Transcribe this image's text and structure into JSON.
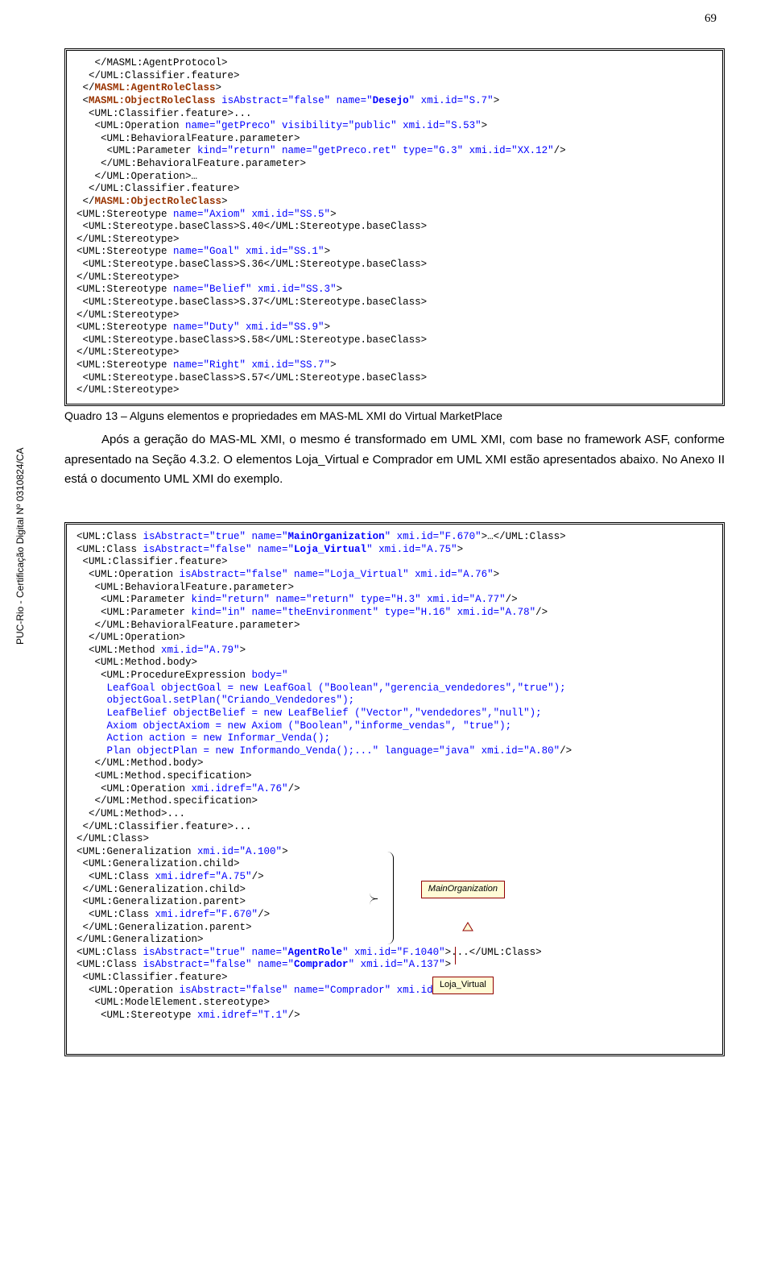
{
  "page_number": "69",
  "vertical_note": "PUC-Rio - Certificação Digital Nº 0310824/CA",
  "code_box_1_html": "   &lt;/MASML:AgentProtocol&gt;\n  &lt;/UML:Classifier.feature&gt;\n &lt;/<span class='brown bold'>MASML:AgentRoleClass</span>&gt;\n &lt;<span class='brown bold'>MASML:ObjectRoleClass</span> <span class='blue'>isAbstract=\"false\"</span> <span class='blue'>name=\"</span><span class='blue bold'>Desejo</span><span class='blue'>\"</span> <span class='blue'>xmi.id=\"S.7\"</span>&gt;\n  &lt;UML:Classifier.feature&gt;...\n   &lt;UML:Operation <span class='blue'>name=\"getPreco\" visibility=\"public\" xmi.id=\"S.53\"</span>&gt;\n    &lt;UML:BehavioralFeature.parameter&gt;\n     &lt;UML:Parameter <span class='blue'>kind=\"return\" name=\"getPreco.ret\" type=\"G.3\" xmi.id=\"XX.12\"</span>/&gt;\n    &lt;/UML:BehavioralFeature.parameter&gt;\n   &lt;/UML:Operation&gt;…\n  &lt;/UML:Classifier.feature&gt;\n &lt;/<span class='brown bold'>MASML:ObjectRoleClass</span>&gt;\n&lt;UML:Stereotype <span class='blue'>name=\"Axiom\" xmi.id=\"SS.5\"</span>&gt;\n &lt;UML:Stereotype.baseClass&gt;S.40&lt;/UML:Stereotype.baseClass&gt;\n&lt;/UML:Stereotype&gt;\n&lt;UML:Stereotype <span class='blue'>name=\"Goal\" xmi.id=\"SS.1\"</span>&gt;\n &lt;UML:Stereotype.baseClass&gt;S.36&lt;/UML:Stereotype.baseClass&gt;\n&lt;/UML:Stereotype&gt;\n&lt;UML:Stereotype <span class='blue'>name=\"Belief\" xmi.id=\"SS.3\"</span>&gt;\n &lt;UML:Stereotype.baseClass&gt;S.37&lt;/UML:Stereotype.baseClass&gt;\n&lt;/UML:Stereotype&gt;\n&lt;UML:Stereotype <span class='blue'>name=\"Duty\" xmi.id=\"SS.9\"</span>&gt;\n &lt;UML:Stereotype.baseClass&gt;S.58&lt;/UML:Stereotype.baseClass&gt;\n&lt;/UML:Stereotype&gt;\n&lt;UML:Stereotype <span class='blue'>name=\"Right\" xmi.id=\"SS.7\"</span>&gt;\n &lt;UML:Stereotype.baseClass&gt;S.57&lt;/UML:Stereotype.baseClass&gt;\n&lt;/UML:Stereotype&gt;",
  "caption_1": "Quadro 13 – Alguns elementos e propriedades em MAS-ML XMI do Virtual MarketPlace",
  "paragraph_1": "Após a geração do MAS-ML XMI, o mesmo é transformado em UML XMI, com base no framework ASF, conforme apresentado na Seção 4.3.2. O elementos Loja_Virtual e Comprador em UML XMI estão apresentados abaixo. No Anexo II está o documento UML XMI do exemplo.",
  "code_box_2_html": "&lt;UML:Class <span class='blue'>isAbstract=\"true\" name=\"</span><span class='blue bold'>MainOrganization</span><span class='blue'>\" xmi.id=\"F.670\"</span>&gt;…&lt;/UML:Class&gt;\n&lt;UML:Class <span class='blue'>isAbstract=\"false\" name=\"</span><span class='blue bold'>Loja_Virtual</span><span class='blue'>\" xmi.id=\"A.75\"</span>&gt;\n &lt;UML:Classifier.feature&gt;\n  &lt;UML:Operation <span class='blue'>isAbstract=\"false\" name=\"Loja_Virtual\" xmi.id=\"A.76\"</span>&gt;\n   &lt;UML:BehavioralFeature.parameter&gt;\n    &lt;UML:Parameter <span class='blue'>kind=\"return\" name=\"return\" type=\"H.3\" xmi.id=\"A.77\"</span>/&gt;\n    &lt;UML:Parameter <span class='blue'>kind=\"in\" name=\"theEnvironment\" type=\"H.16\" xmi.id=\"A.78\"</span>/&gt;\n   &lt;/UML:BehavioralFeature.parameter&gt;\n  &lt;/UML:Operation&gt;\n  &lt;UML:Method <span class='blue'>xmi.id=\"A.79\"</span>&gt;\n   &lt;UML:Method.body&gt;\n    &lt;UML:ProcedureExpression <span class='blue'>body=\"</span>\n     <span class='blue'>LeafGoal objectGoal = new LeafGoal (\"Boolean\",\"gerencia_vendedores\",\"true\");</span>\n     <span class='blue'>objectGoal.setPlan(\"Criando_Vendedores\");</span>\n     <span class='blue'>LeafBelief objectBelief = new LeafBelief (\"Vector\",\"vendedores\",\"null\");</span>\n     <span class='blue'>Axiom objectAxiom = new Axiom (\"Boolean\",\"informe_vendas\", \"true\");</span>\n     <span class='blue'>Action action = new Informar_Venda();</span>\n     <span class='blue'>Plan objectPlan = new Informando_Venda();...\" language=\"java\" xmi.id=\"A.80\"</span>/&gt;\n   &lt;/UML:Method.body&gt;\n   &lt;UML:Method.specification&gt;\n    &lt;UML:Operation <span class='blue'>xmi.idref=\"A.76\"</span>/&gt;\n   &lt;/UML:Method.specification&gt;\n  &lt;/UML:Method&gt;...\n &lt;/UML:Classifier.feature&gt;...\n&lt;/UML:Class&gt;\n&lt;UML:Generalization <span class='blue'>xmi.id=\"A.100\"</span>&gt;\n &lt;UML:Generalization.child&gt;\n  &lt;UML:Class <span class='blue'>xmi.idref=\"A.75\"</span>/&gt;\n &lt;/UML:Generalization.child&gt;\n &lt;UML:Generalization.parent&gt;\n  &lt;UML:Class <span class='blue'>xmi.idref=\"F.670\"</span>/&gt;\n &lt;/UML:Generalization.parent&gt;\n&lt;/UML:Generalization&gt;\n&lt;UML:Class <span class='blue'>isAbstract=\"true\" name=\"</span><span class='blue bold'>AgentRole</span><span class='blue'>\" xmi.id=\"F.1040\"</span>&gt;...&lt;/UML:Class&gt;\n&lt;UML:Class <span class='blue'>isAbstract=\"false\" name=\"</span><span class='blue bold'>Comprador</span><span class='blue'>\" xmi.id=\"A.137\"</span>&gt;\n &lt;UML:Classifier.feature&gt;\n  &lt;UML:Operation <span class='blue'>isAbstract=\"false\" name=\"Comprador\" xmi.id=\"A.138\"</span>&gt;\n   &lt;UML:ModelElement.stereotype&gt;\n    &lt;UML:Stereotype <span class='blue'>xmi.idref=\"T.1\"</span>/&gt;",
  "diagram": {
    "top_label": "MainOrganization",
    "bottom_label": "Loja_Virtual"
  }
}
